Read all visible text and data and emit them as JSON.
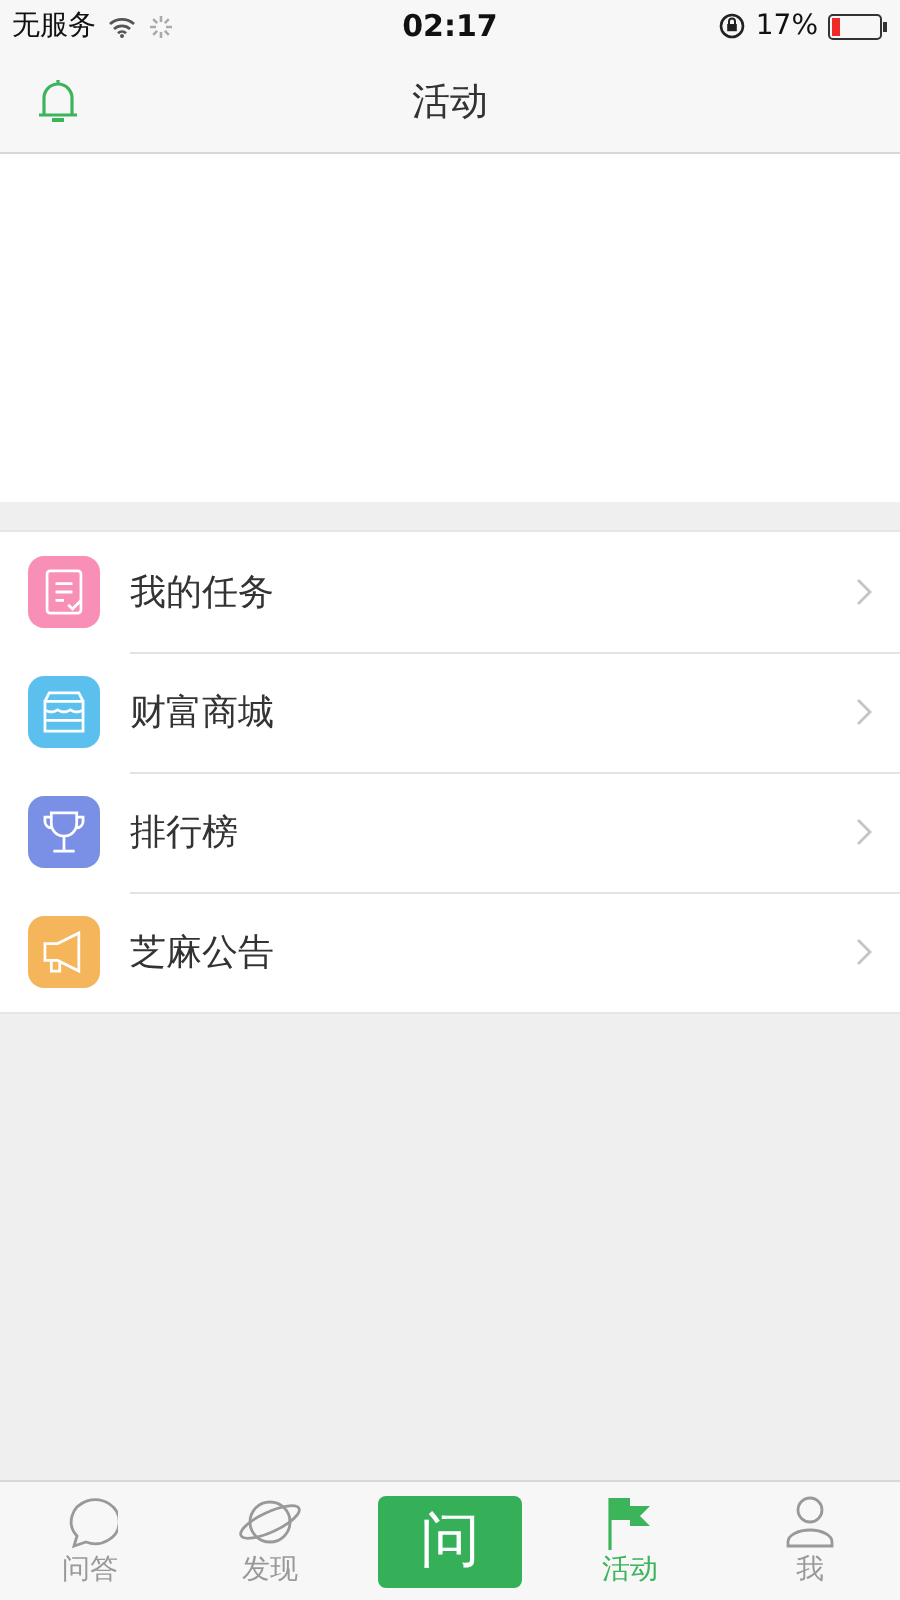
{
  "status_bar": {
    "carrier": "无服务",
    "time": "02:17",
    "battery": "17%"
  },
  "nav_bar": {
    "title": "活动"
  },
  "menu": [
    {
      "label": "我的任务",
      "color": "#f78fb6"
    },
    {
      "label": "财富商城",
      "color": "#5bc0ee"
    },
    {
      "label": "排行榜",
      "color": "#7a8fe6"
    },
    {
      "label": "芝麻公告",
      "color": "#f5b65b"
    }
  ],
  "tab_bar": [
    {
      "kind": "tab",
      "label": "问答",
      "selected": false
    },
    {
      "kind": "tab",
      "label": "发现",
      "selected": false
    },
    {
      "kind": "action",
      "label": "问"
    },
    {
      "kind": "tab",
      "label": "活动",
      "selected": true
    },
    {
      "kind": "tab",
      "label": "我",
      "selected": false
    }
  ]
}
